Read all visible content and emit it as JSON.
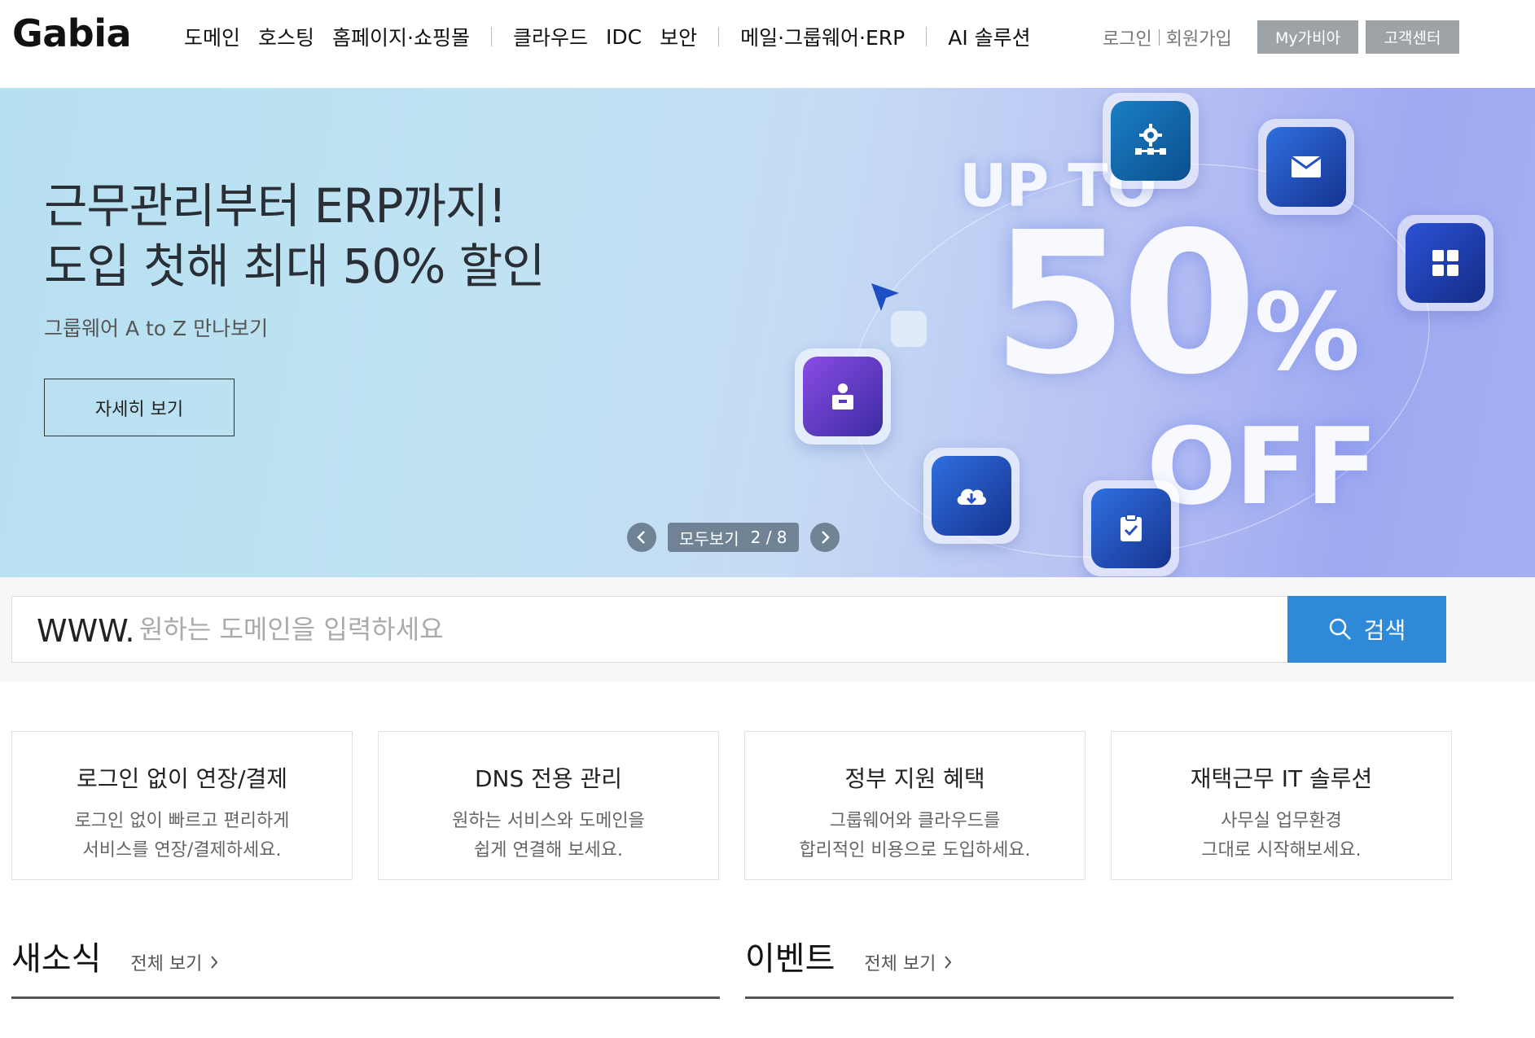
{
  "header": {
    "logo": "Gabia",
    "nav": [
      "도메인",
      "호스팅",
      "홈페이지·쇼핑몰",
      "클라우드",
      "IDC",
      "보안",
      "메일·그룹웨어·ERP",
      "AI 솔루션"
    ],
    "login": "로그인",
    "signup": "회원가입",
    "my_button": "My가비아",
    "cs_button": "고객센터"
  },
  "banner": {
    "title_line1": "근무관리부터 ERP까지!",
    "title_line2": "도입 첫해 최대 50% 할인",
    "subtitle": "그룹웨어 A to Z 만나보기",
    "cta": "자세히 보기",
    "promo_upto": "UP TO",
    "promo_number": "50",
    "promo_percent": "%",
    "promo_off": "OFF",
    "view_all": "모두보기",
    "page_indicator": "2 / 8"
  },
  "search": {
    "prefix": "WWW.",
    "placeholder": "원하는 도메인을 입력하세요",
    "value": "",
    "button": "검색"
  },
  "cards": [
    {
      "title": "로그인 없이 연장/결제",
      "line1": "로그인 없이 빠르고 편리하게",
      "line2": "서비스를 연장/결제하세요."
    },
    {
      "title": "DNS 전용 관리",
      "line1": "원하는 서비스와 도메인을",
      "line2": "쉽게 연결해 보세요."
    },
    {
      "title": "정부 지원 혜택",
      "line1": "그룹웨어와 클라우드를",
      "line2": "합리적인 비용으로 도입하세요."
    },
    {
      "title": "재택근무 IT 솔루션",
      "line1": "사무실 업무환경",
      "line2": "그대로 시작해보세요."
    }
  ],
  "news": {
    "title": "새소식",
    "more": "전체 보기"
  },
  "events": {
    "title": "이벤트",
    "more": "전체 보기"
  },
  "colors": {
    "search_button": "#2e8ad8",
    "header_button": "#9ea3a8",
    "pager": "#6f8394"
  },
  "icons": [
    "gear-network-icon",
    "mail-icon",
    "grid-apps-icon",
    "user-badge-icon",
    "cloud-download-icon",
    "clipboard-check-icon",
    "cursor-arrow-icon",
    "search-icon",
    "chevron-left-icon",
    "chevron-right-icon"
  ]
}
